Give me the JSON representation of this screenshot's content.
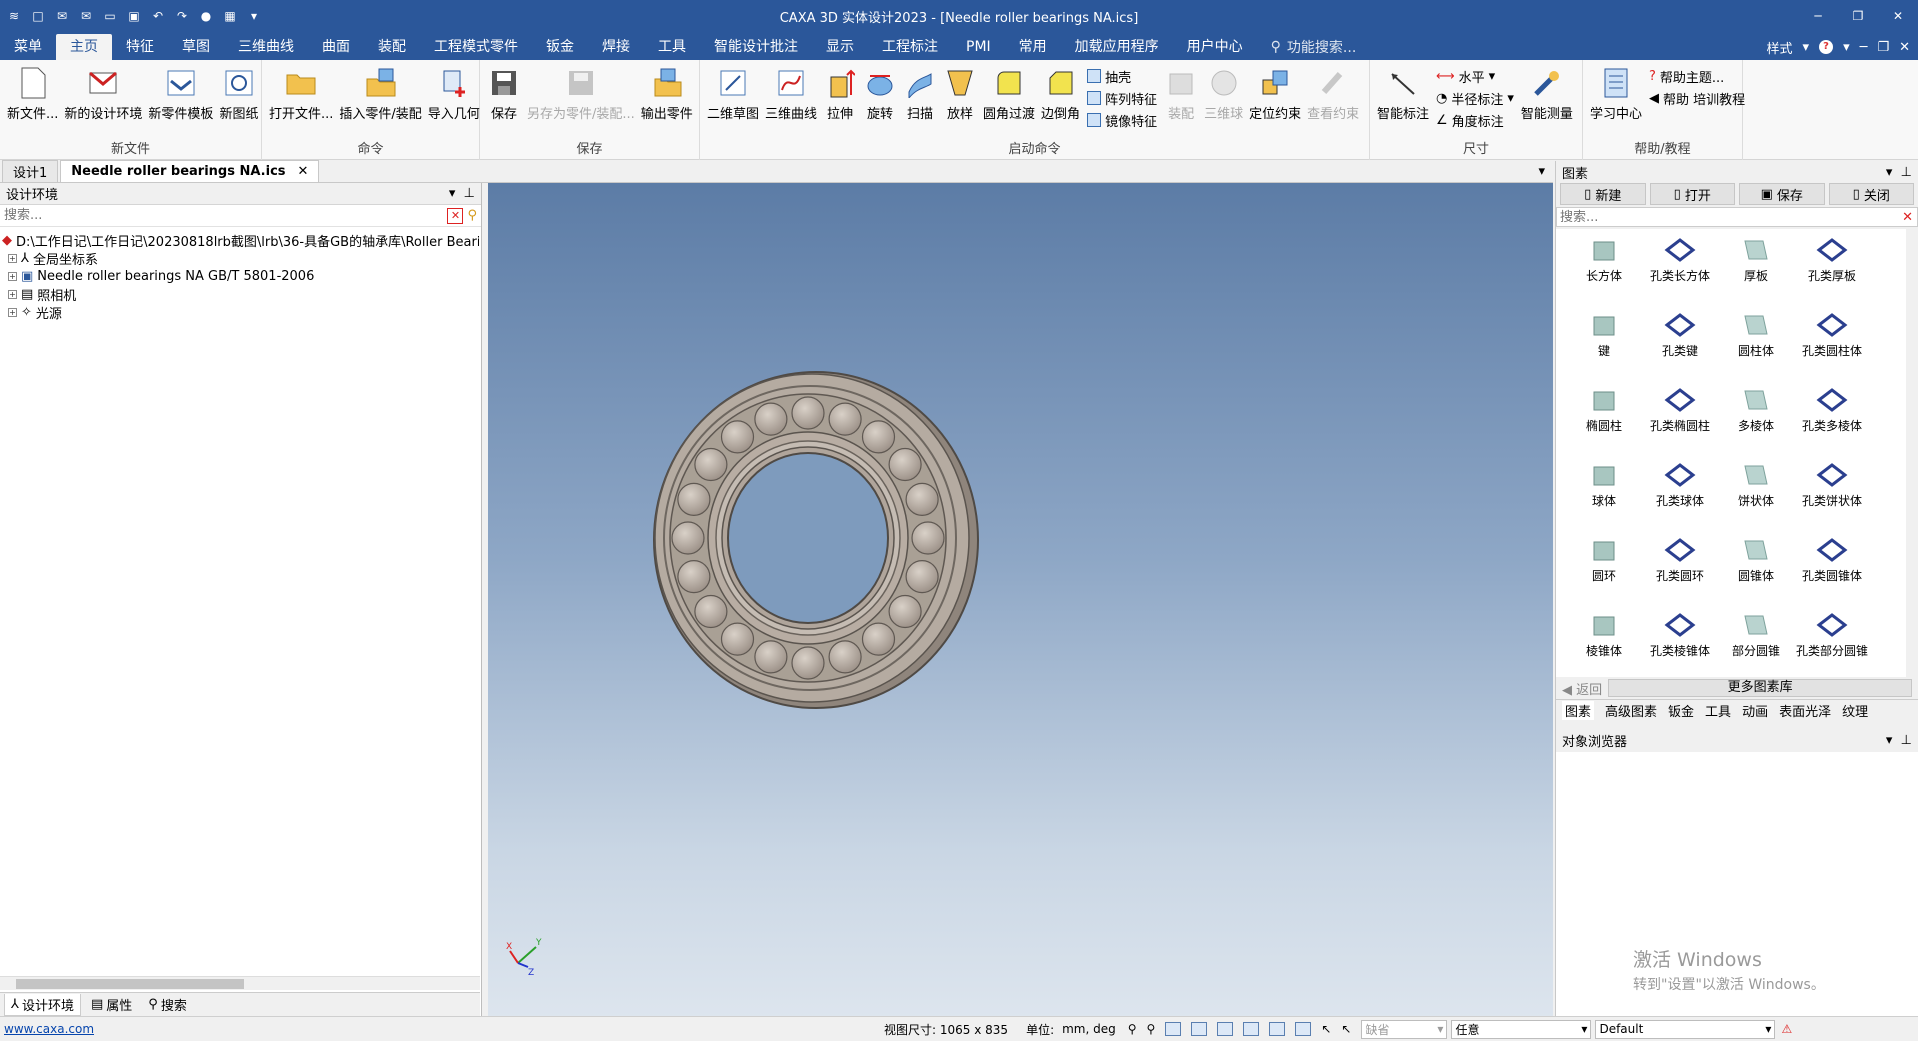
{
  "title": "CAXA 3D 实体设计2023 - [Needle roller bearings NA.ics]",
  "menubar": {
    "items": [
      "菜单",
      "主页",
      "特征",
      "草图",
      "三维曲线",
      "曲面",
      "装配",
      "工程模式零件",
      "钣金",
      "焊接",
      "工具",
      "智能设计批注",
      "显示",
      "工程标注",
      "PMI",
      "常用",
      "加载应用程序",
      "用户中心"
    ],
    "active": "主页",
    "search_label": "功能搜索...",
    "style_label": "样式"
  },
  "ribbon": {
    "groups": [
      {
        "label": "新文件",
        "buttons": [
          "新文件...",
          "新的设计环境",
          "新零件模板",
          "新图纸"
        ]
      },
      {
        "label": "命令",
        "buttons": [
          "打开文件...",
          "插入零件/装配",
          "导入几何"
        ]
      },
      {
        "label": "保存",
        "buttons": [
          "保存",
          "另存为零件/装配...",
          "输出零件"
        ]
      },
      {
        "label": "启动命令",
        "buttons": [
          "二维草图",
          "三维曲线",
          "拉伸",
          "旋转",
          "扫描",
          "放样",
          "圆角过渡",
          "边倒角"
        ],
        "small": [
          "抽壳",
          "阵列特征",
          "镜像特征"
        ],
        "disabled": [
          "装配",
          "三维球",
          "查看约束"
        ],
        "extra": [
          "定位约束"
        ]
      },
      {
        "label": "尺寸",
        "buttons": [
          "智能标注"
        ],
        "small": [
          "水平",
          "半径标注",
          "角度标注"
        ],
        "extra": [
          "智能测量"
        ]
      },
      {
        "label": "帮助/教程",
        "buttons": [
          "学习中心"
        ],
        "small": [
          "帮助主题...",
          "帮助 培训教程"
        ]
      }
    ]
  },
  "doctabs": [
    "设计1",
    "Needle roller bearings NA.ics"
  ],
  "left_panel": {
    "title": "设计环境",
    "search_placeholder": "搜索...",
    "tree": [
      "D:\\工作日记\\工作日记\\20230818lrb截图\\lrb\\36-具备GB的轴承库\\Roller Bearings\\",
      "全局坐标系",
      "Needle roller bearings NA GB/T 5801-2006",
      "照相机",
      "光源"
    ],
    "tabs": [
      "设计环境",
      "属性",
      "搜索"
    ]
  },
  "viewport": {
    "axis_labels": [
      "X",
      "Y",
      "Z"
    ]
  },
  "right_panel": {
    "title": "图素",
    "buttons": [
      "新建",
      "打开",
      "保存",
      "关闭"
    ],
    "search_placeholder": "搜索...",
    "items": [
      "长方体",
      "孔类长方体",
      "厚板",
      "孔类厚板",
      "键",
      "孔类键",
      "圆柱体",
      "孔类圆柱体",
      "椭圆柱",
      "孔类椭圆柱",
      "多棱体",
      "孔类多棱体",
      "球体",
      "孔类球体",
      "饼状体",
      "孔类饼状体",
      "圆环",
      "孔类圆环",
      "圆锥体",
      "孔类圆锥体",
      "棱锥体",
      "孔类棱锥体",
      "部分圆锥",
      "孔类部分圆锥"
    ],
    "back_label": "返回",
    "more_label": "更多图素库",
    "tabs": [
      "图素",
      "高级图素",
      "钣金",
      "工具",
      "动画",
      "表面光泽",
      "纹理"
    ],
    "object_browser": "对象浏览器"
  },
  "watermark": {
    "line1": "激活 Windows",
    "line2": "转到\"设置\"以激活 Windows。"
  },
  "status": {
    "link": "www.caxa.com",
    "view_size": "视图尺寸: 1065 x  835",
    "unit_label": "单位:",
    "unit_value": "mm, deg",
    "combo1": "缺省",
    "combo2": "任意",
    "combo3": "Default"
  },
  "colors": {
    "title_bar": "#2b579a",
    "bearing": "#b5aba1"
  }
}
